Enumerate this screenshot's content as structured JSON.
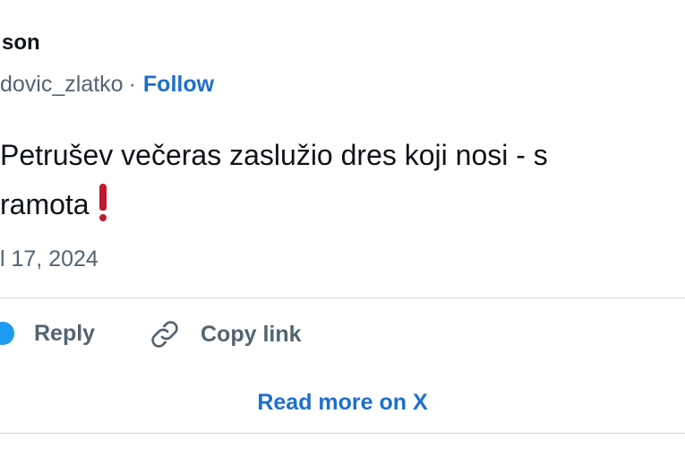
{
  "author": {
    "name": "son",
    "handle": "dovic_zlatko",
    "separator": "·",
    "follow_label": "Follow"
  },
  "tweet": {
    "line1": "Petrušev večeras zaslužio dres koji nosi - s",
    "line2": "ramota",
    "emoji": "heavy-exclamation-mark-icon",
    "timestamp": "l 17, 2024"
  },
  "actions": {
    "reply_label": "Reply",
    "copy_link_label": "Copy link",
    "read_more_label": "Read more on X"
  },
  "colors": {
    "link": "#1d6fcc",
    "muted": "#536471",
    "text": "#0f1419",
    "accent": "#1d9bf0",
    "emoji_red": "#be1931",
    "divider": "#cfd9de"
  }
}
